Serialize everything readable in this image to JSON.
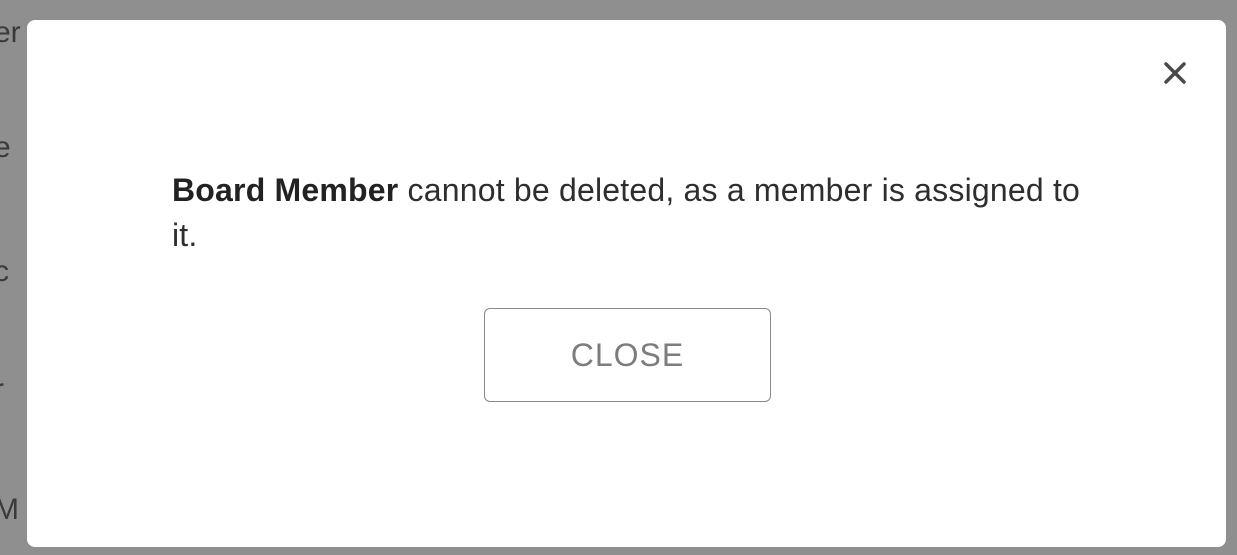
{
  "backdrop": {
    "fragments": [
      "er",
      "e",
      "c",
      "r",
      "M"
    ]
  },
  "dialog": {
    "close_icon": "close-icon",
    "message_bold": "Board Member",
    "message_rest": " cannot be deleted, as a member is assigned to it.",
    "close_button_label": "CLOSE"
  },
  "colors": {
    "overlay": "#8f8f8f",
    "dialog_background": "#ffffff",
    "text": "#2e2e2e",
    "button_border": "#8a8a8a",
    "button_text": "#7d7d7d"
  }
}
